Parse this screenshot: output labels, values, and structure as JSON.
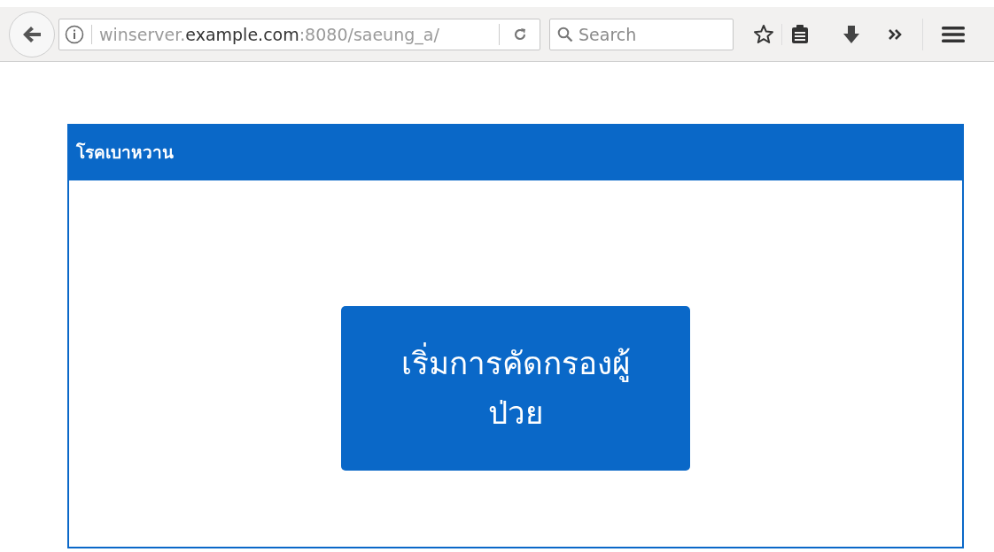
{
  "browser": {
    "url": {
      "prefix": "winserver.",
      "domain": "example.com",
      "suffix": ":8080/saeung_a/"
    },
    "search": {
      "placeholder": "Search"
    }
  },
  "panel": {
    "title": "โรคเบาหวาน",
    "button": "เริ่มการคัดกรองผู้ป่วย"
  }
}
